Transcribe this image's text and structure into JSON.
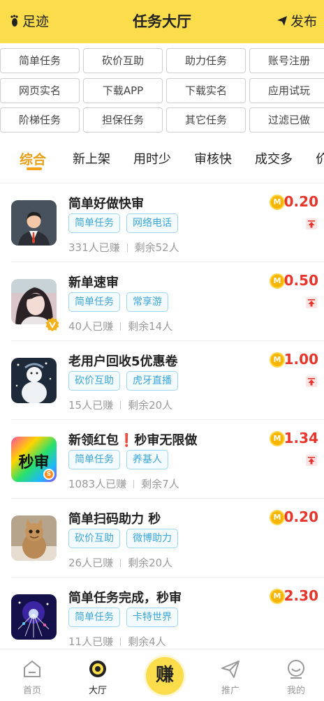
{
  "header": {
    "left_label": "足迹",
    "title": "任务大厅",
    "right_label": "发布",
    "bg_color": "#fbdd4c"
  },
  "categories": [
    "简单任务",
    "砍价互助",
    "助力任务",
    "账号注册",
    "网页实名",
    "下载APP",
    "下载实名",
    "应用试玩",
    "阶梯任务",
    "担保任务",
    "其它任务",
    "过滤已做"
  ],
  "sort_tabs": [
    "综合",
    "新上架",
    "用时少",
    "审核快",
    "成交多",
    "价"
  ],
  "sort_active": "综合",
  "tasks": [
    {
      "title": "简单好做快审",
      "tags": [
        "简单任务",
        "网络电话"
      ],
      "earned": "331人已赚",
      "remaining": "剩余52人",
      "coin": "M",
      "price": "0.20"
    },
    {
      "title": "新单速审",
      "tags": [
        "简单任务",
        "常享游"
      ],
      "earned": "40人已赚",
      "remaining": "剩余14人",
      "coin": "M",
      "price": "0.50"
    },
    {
      "title": "老用户回收5优惠卷",
      "tags": [
        "砍价互助",
        "虎牙直播"
      ],
      "earned": "15人已赚",
      "remaining": "剩余20人",
      "coin": "M",
      "price": "1.00"
    },
    {
      "title": "新领红包❗秒审无限做",
      "tags": [
        "简单任务",
        "养基人"
      ],
      "earned": "1083人已赚",
      "remaining": "剩余7人",
      "coin": "M",
      "price": "1.34",
      "avatar_text": "秒审"
    },
    {
      "title": "简单扫码助力 秒",
      "tags": [
        "砍价互助",
        "微博助力"
      ],
      "earned": "26人已赚",
      "remaining": "剩余20人",
      "coin": "M",
      "price": "0.20"
    },
    {
      "title": "简单任务完成，秒审",
      "tags": [
        "简单任务",
        "卡特世界"
      ],
      "earned": "11人已赚",
      "remaining": "剩余4人",
      "coin": "M",
      "price": "2.30"
    }
  ],
  "tabbar": {
    "home": "首页",
    "hall": "大厅",
    "earn": "赚",
    "promote": "推广",
    "mine": "我的"
  }
}
